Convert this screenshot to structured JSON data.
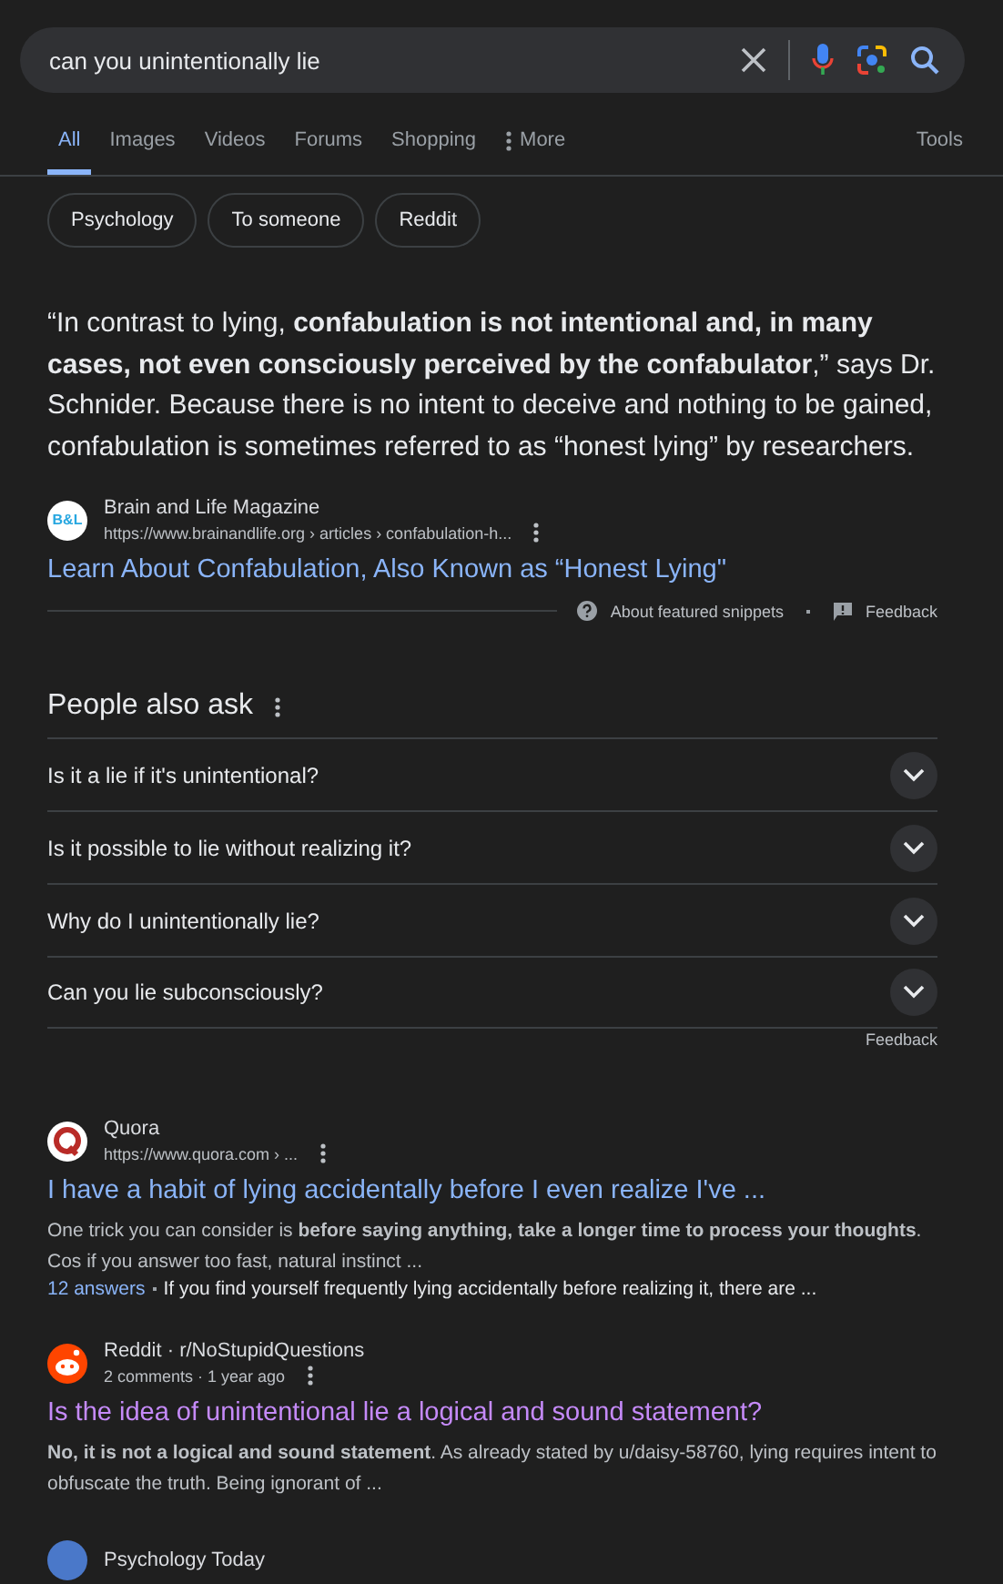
{
  "search": {
    "query": "can you unintentionally lie"
  },
  "tabs": [
    {
      "label": "All",
      "selected": true
    },
    {
      "label": "Images",
      "selected": false
    },
    {
      "label": "Videos",
      "selected": false
    },
    {
      "label": "Forums",
      "selected": false
    },
    {
      "label": "Shopping",
      "selected": false
    },
    {
      "label": "More",
      "selected": false,
      "kind": "menu"
    }
  ],
  "tools": "Tools",
  "chips": [
    "Psychology",
    "To someone",
    "Reddit"
  ],
  "featured_snippet": {
    "text": "“In contrast to lying, **confabulation is not intentional and, in many cases, not even consciously perceived by the confabulator**,” says Dr. Schnider. Because there is no intent to deceive and nothing to be gained, confabulation is sometimes referred to as “honest lying” by researchers.",
    "source": "Brain and Life Magazine",
    "favicon_text": "B&L",
    "url": "https://www.brainandlife.org › articles › confabulation-h...",
    "title": "Learn About Confabulation, Also Known as “Honest Lying\"",
    "about": "About featured snippets",
    "feedback": "Feedback"
  },
  "people_also_ask": {
    "heading": "People also ask",
    "questions": [
      {
        "text": "Is it a lie if it's unintentional?",
        "expanded": false
      },
      {
        "text": "Is it possible to lie without realizing it?",
        "expanded": false
      },
      {
        "text": "Why do I unintentionally lie?",
        "expanded": false
      },
      {
        "text": "Can you lie subconsciously?",
        "expanded": false
      }
    ],
    "feedback": "Feedback"
  },
  "results": [
    {
      "kind": "quora",
      "source": "Quora",
      "meta": "https://www.quora.com › ...",
      "title": "I have a habit of lying accidentally before I even realize I've ...",
      "visited": false,
      "snippet": "One trick you can consider is **before saying anything, take a longer time to process your thoughts**. Cos if you answer too fast, natural instinct ...",
      "extra_link": "12 answers",
      "extra_text": "If you find yourself frequently lying accidentally before realizing it, there are ..."
    },
    {
      "kind": "reddit",
      "source": "Reddit · r/NoStupidQuestions",
      "meta": "2 comments · 1 year ago",
      "title": "Is the idea of unintentional lie a logical and sound statement?",
      "visited": true,
      "snippet": "**No, it is not a logical and sound statement**. As already stated by u/daisy-58760, lying requires intent to obfuscate the truth. Being ignorant of ..."
    },
    {
      "kind": "generic",
      "source": "Psychology Today"
    }
  ]
}
